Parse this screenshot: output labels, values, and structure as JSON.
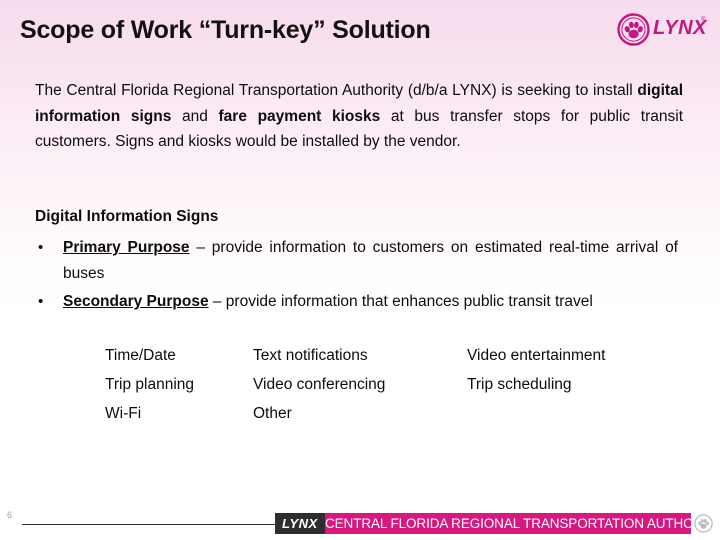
{
  "slide": {
    "title": "Scope of Work “Turn-key” Solution",
    "page_number": "6",
    "accent_color": "#d6187f",
    "logo_color": "#c2187f",
    "background_top_color": "#f7dced",
    "background_bottom_color": "#ffffff"
  },
  "logo": {
    "wordmark": "LYNX",
    "trademark": "®",
    "icon": "paw-in-circle-icon"
  },
  "intro": {
    "part1": "The Central Florida Regional Transportation Authority (d/b/a LYNX) is seeking to install ",
    "bold1": "digital information signs",
    "part2": " and ",
    "bold2": "fare payment kiosks",
    "part3": " at bus transfer stops for public transit customers.  Signs and kiosks would be installed by the vendor."
  },
  "section": {
    "heading": "Digital Information Signs",
    "bullets": [
      {
        "marker": "•",
        "lead": "Primary Purpose",
        "rest": " – provide information to customers on estimated real-time arrival of buses"
      },
      {
        "marker": "•",
        "lead": "Secondary  Purpose",
        "rest": " – provide information that enhances public transit travel"
      }
    ]
  },
  "features": {
    "rows": [
      [
        "Time/Date",
        "Text notifications",
        "Video entertainment"
      ],
      [
        "Trip planning",
        "Video conferencing",
        "Trip scheduling"
      ],
      [
        "Wi-Fi",
        "Other",
        ""
      ]
    ]
  },
  "footer": {
    "lynx_label": "LYNX",
    "band_text": "CENTRAL FLORIDA REGIONAL TRANSPORTATION AUTHORITY",
    "paw_icon": "paw-in-circle-icon"
  }
}
